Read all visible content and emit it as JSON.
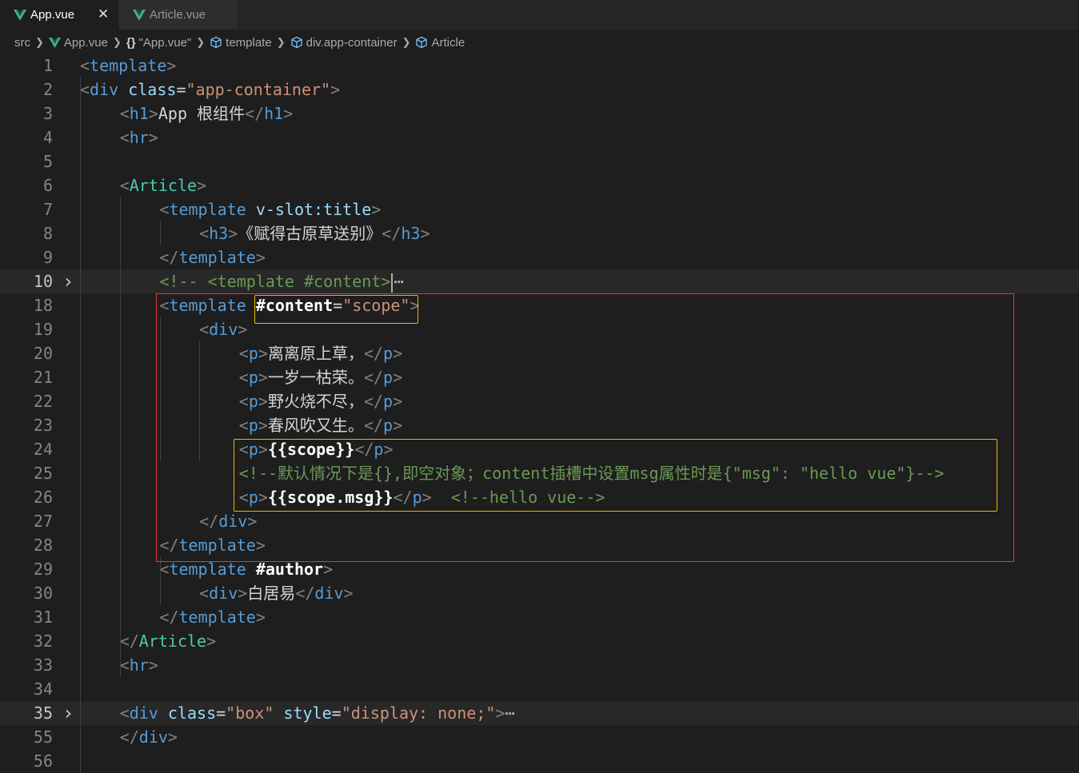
{
  "tabs": [
    {
      "label": "App.vue",
      "active": true,
      "icon": "vue-icon"
    },
    {
      "label": "Article.vue",
      "active": false,
      "icon": "vue-icon"
    }
  ],
  "tab_close_glyph": "✕",
  "breadcrumb": [
    {
      "label": "src",
      "icon": ""
    },
    {
      "label": "App.vue",
      "icon": "vue-icon"
    },
    {
      "label": "\"App.vue\"",
      "icon": "braces-icon"
    },
    {
      "label": "template",
      "icon": "cube-icon"
    },
    {
      "label": "div.app-container",
      "icon": "cube-icon"
    },
    {
      "label": "Article",
      "icon": "cube-icon"
    }
  ],
  "colors": {
    "background": "#1e1e1e",
    "tag": "#569cd6",
    "component": "#4ec9b0",
    "attribute": "#9cdcfe",
    "string": "#ce9178",
    "comment": "#6a9955",
    "highlight_red": "#e53935",
    "highlight_yellow": "#f0b400"
  },
  "lines": [
    {
      "n": "1",
      "indent": 0,
      "tokens": [
        [
          "br",
          "<"
        ],
        [
          "tag",
          "template"
        ],
        [
          "br",
          ">"
        ]
      ]
    },
    {
      "n": "2",
      "indent": 0,
      "tokens": [
        [
          "br",
          "<"
        ],
        [
          "tag",
          "div"
        ],
        [
          "txt",
          " "
        ],
        [
          "attr",
          "class"
        ],
        [
          "txt",
          "="
        ],
        [
          "str",
          "\"app-container\""
        ],
        [
          "br",
          ">"
        ]
      ]
    },
    {
      "n": "3",
      "indent": 1,
      "tokens": [
        [
          "br",
          "<"
        ],
        [
          "tag",
          "h1"
        ],
        [
          "br",
          ">"
        ],
        [
          "txt",
          "App 根组件"
        ],
        [
          "br",
          "</"
        ],
        [
          "tag",
          "h1"
        ],
        [
          "br",
          ">"
        ]
      ]
    },
    {
      "n": "4",
      "indent": 1,
      "tokens": [
        [
          "br",
          "<"
        ],
        [
          "tag",
          "hr"
        ],
        [
          "br",
          ">"
        ]
      ]
    },
    {
      "n": "5",
      "indent": 1,
      "tokens": []
    },
    {
      "n": "6",
      "indent": 1,
      "tokens": [
        [
          "br",
          "<"
        ],
        [
          "comp",
          "Article"
        ],
        [
          "br",
          ">"
        ]
      ]
    },
    {
      "n": "7",
      "indent": 2,
      "tokens": [
        [
          "br",
          "<"
        ],
        [
          "tag",
          "template"
        ],
        [
          "txt",
          " "
        ],
        [
          "dir",
          "v-slot:title"
        ],
        [
          "br",
          ">"
        ]
      ]
    },
    {
      "n": "8",
      "indent": 3,
      "tokens": [
        [
          "br",
          "<"
        ],
        [
          "tag",
          "h3"
        ],
        [
          "br",
          ">"
        ],
        [
          "txt",
          "《赋得古原草送别》"
        ],
        [
          "br",
          "</"
        ],
        [
          "tag",
          "h3"
        ],
        [
          "br",
          ">"
        ]
      ]
    },
    {
      "n": "9",
      "indent": 2,
      "tokens": [
        [
          "br",
          "</"
        ],
        [
          "tag",
          "template"
        ],
        [
          "br",
          ">"
        ]
      ]
    },
    {
      "n": "10",
      "indent": 2,
      "current": true,
      "fold": true,
      "tokens": [
        [
          "com",
          "<!-- <template #content>"
        ],
        [
          "cursor",
          ""
        ],
        [
          "ell",
          "⋯"
        ]
      ]
    },
    {
      "n": "18",
      "indent": 2,
      "tokens": [
        [
          "br",
          "<"
        ],
        [
          "tag",
          "template"
        ],
        [
          "txt",
          " "
        ],
        [
          "bold",
          "#content"
        ],
        [
          "txt",
          "="
        ],
        [
          "str",
          "\"scope\""
        ],
        [
          "br",
          ">"
        ]
      ]
    },
    {
      "n": "19",
      "indent": 3,
      "tokens": [
        [
          "br",
          "<"
        ],
        [
          "tag",
          "div"
        ],
        [
          "br",
          ">"
        ]
      ]
    },
    {
      "n": "20",
      "indent": 4,
      "tokens": [
        [
          "br",
          "<"
        ],
        [
          "tag",
          "p"
        ],
        [
          "br",
          ">"
        ],
        [
          "txt",
          "离离原上草，"
        ],
        [
          "br",
          "</"
        ],
        [
          "tag",
          "p"
        ],
        [
          "br",
          ">"
        ]
      ]
    },
    {
      "n": "21",
      "indent": 4,
      "tokens": [
        [
          "br",
          "<"
        ],
        [
          "tag",
          "p"
        ],
        [
          "br",
          ">"
        ],
        [
          "txt",
          "一岁一枯荣。"
        ],
        [
          "br",
          "</"
        ],
        [
          "tag",
          "p"
        ],
        [
          "br",
          ">"
        ]
      ]
    },
    {
      "n": "22",
      "indent": 4,
      "tokens": [
        [
          "br",
          "<"
        ],
        [
          "tag",
          "p"
        ],
        [
          "br",
          ">"
        ],
        [
          "txt",
          "野火烧不尽，"
        ],
        [
          "br",
          "</"
        ],
        [
          "tag",
          "p"
        ],
        [
          "br",
          ">"
        ]
      ]
    },
    {
      "n": "23",
      "indent": 4,
      "tokens": [
        [
          "br",
          "<"
        ],
        [
          "tag",
          "p"
        ],
        [
          "br",
          ">"
        ],
        [
          "txt",
          "春风吹又生。"
        ],
        [
          "br",
          "</"
        ],
        [
          "tag",
          "p"
        ],
        [
          "br",
          ">"
        ]
      ]
    },
    {
      "n": "24",
      "indent": 4,
      "tokens": [
        [
          "br",
          "<"
        ],
        [
          "tag",
          "p"
        ],
        [
          "br",
          ">"
        ],
        [
          "bold",
          "{{scope}}"
        ],
        [
          "br",
          "</"
        ],
        [
          "tag",
          "p"
        ],
        [
          "br",
          ">"
        ]
      ]
    },
    {
      "n": "25",
      "indent": 4,
      "tokens": [
        [
          "com",
          "<!--默认情况下是{},即空对象；content插槽中设置msg属性时是{\"msg\": \"hello vue\"}-->"
        ]
      ]
    },
    {
      "n": "26",
      "indent": 4,
      "tokens": [
        [
          "br",
          "<"
        ],
        [
          "tag",
          "p"
        ],
        [
          "br",
          ">"
        ],
        [
          "bold",
          "{{scope.msg}}"
        ],
        [
          "br",
          "</"
        ],
        [
          "tag",
          "p"
        ],
        [
          "br",
          ">"
        ],
        [
          "txt",
          "  "
        ],
        [
          "com",
          "<!--hello vue-->"
        ]
      ]
    },
    {
      "n": "27",
      "indent": 3,
      "tokens": [
        [
          "br",
          "</"
        ],
        [
          "tag",
          "div"
        ],
        [
          "br",
          ">"
        ]
      ]
    },
    {
      "n": "28",
      "indent": 2,
      "tokens": [
        [
          "br",
          "</"
        ],
        [
          "tag",
          "template"
        ],
        [
          "br",
          ">"
        ]
      ]
    },
    {
      "n": "29",
      "indent": 2,
      "tokens": [
        [
          "br",
          "<"
        ],
        [
          "tag",
          "template"
        ],
        [
          "txt",
          " "
        ],
        [
          "bold",
          "#author"
        ],
        [
          "br",
          ">"
        ]
      ]
    },
    {
      "n": "30",
      "indent": 3,
      "tokens": [
        [
          "br",
          "<"
        ],
        [
          "tag",
          "div"
        ],
        [
          "br",
          ">"
        ],
        [
          "txt",
          "白居易"
        ],
        [
          "br",
          "</"
        ],
        [
          "tag",
          "div"
        ],
        [
          "br",
          ">"
        ]
      ]
    },
    {
      "n": "31",
      "indent": 2,
      "tokens": [
        [
          "br",
          "</"
        ],
        [
          "tag",
          "template"
        ],
        [
          "br",
          ">"
        ]
      ]
    },
    {
      "n": "32",
      "indent": 1,
      "tokens": [
        [
          "br",
          "</"
        ],
        [
          "comp",
          "Article"
        ],
        [
          "br",
          ">"
        ]
      ]
    },
    {
      "n": "33",
      "indent": 1,
      "tokens": [
        [
          "br",
          "<"
        ],
        [
          "tag",
          "hr"
        ],
        [
          "br",
          ">"
        ]
      ]
    },
    {
      "n": "34",
      "indent": 1,
      "tokens": []
    },
    {
      "n": "35",
      "indent": 1,
      "current": true,
      "fold": true,
      "tokens": [
        [
          "br",
          "<"
        ],
        [
          "tag",
          "div"
        ],
        [
          "txt",
          " "
        ],
        [
          "attr",
          "class"
        ],
        [
          "txt",
          "="
        ],
        [
          "str",
          "\"box\""
        ],
        [
          "txt",
          " "
        ],
        [
          "attr",
          "style"
        ],
        [
          "txt",
          "="
        ],
        [
          "str",
          "\"display: none;\""
        ],
        [
          "br",
          ">"
        ],
        [
          "ell",
          "⋯"
        ]
      ]
    },
    {
      "n": "55",
      "indent": 1,
      "tokens": [
        [
          "br",
          "</"
        ],
        [
          "tag",
          "div"
        ],
        [
          "br",
          ">"
        ]
      ]
    },
    {
      "n": "56",
      "indent": 0,
      "tokens": []
    }
  ]
}
